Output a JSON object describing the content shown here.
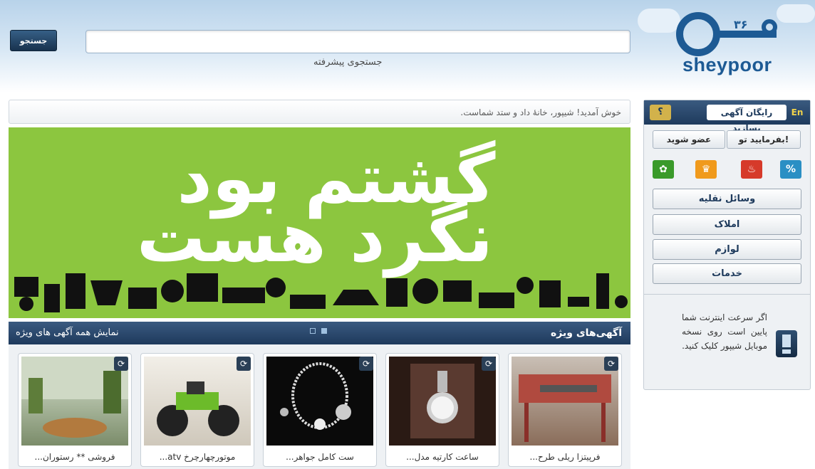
{
  "header": {
    "search_button": "جستجو",
    "search_placeholder": "",
    "advanced_search": "جستجوی پیشرفته",
    "logo_text": "sheypoor"
  },
  "welcome_text": "خوش آمدید! شیپور، خانهٔ داد و ستد شماست.",
  "banner": {
    "line1": "گشتم بود",
    "line2": "نگرد هست"
  },
  "featured": {
    "title": "آگهی‌های ویژه",
    "show_all": "نمایش همه آگهی های ویژه",
    "cards": [
      {
        "caption": "فرپیتزا ریلی طرح..."
      },
      {
        "caption": "ساعت کارتیه مدل..."
      },
      {
        "caption": "ست کامل جواهر..."
      },
      {
        "caption": "موتورچهارچرخ atv..."
      },
      {
        "caption": "فروشی ** رستوران..."
      }
    ]
  },
  "sidebar": {
    "en": "En",
    "free_ad": "رایگان آگهی بسازید",
    "help": "؟",
    "login": "بفرمایید تو!",
    "register": "عضو شوید",
    "categories": [
      "وسائل نقلیه",
      "املاک",
      "لوازم",
      "خدمات"
    ],
    "mobile_text": "اگر سرعت اینترنت شما پایین است روی نسخه موبایل شیپور کلیک کنید."
  },
  "colors": {
    "banner_green": "#8cc63f",
    "dark_blue": "#1e3a5c",
    "logo_blue": "#1d5a94"
  }
}
